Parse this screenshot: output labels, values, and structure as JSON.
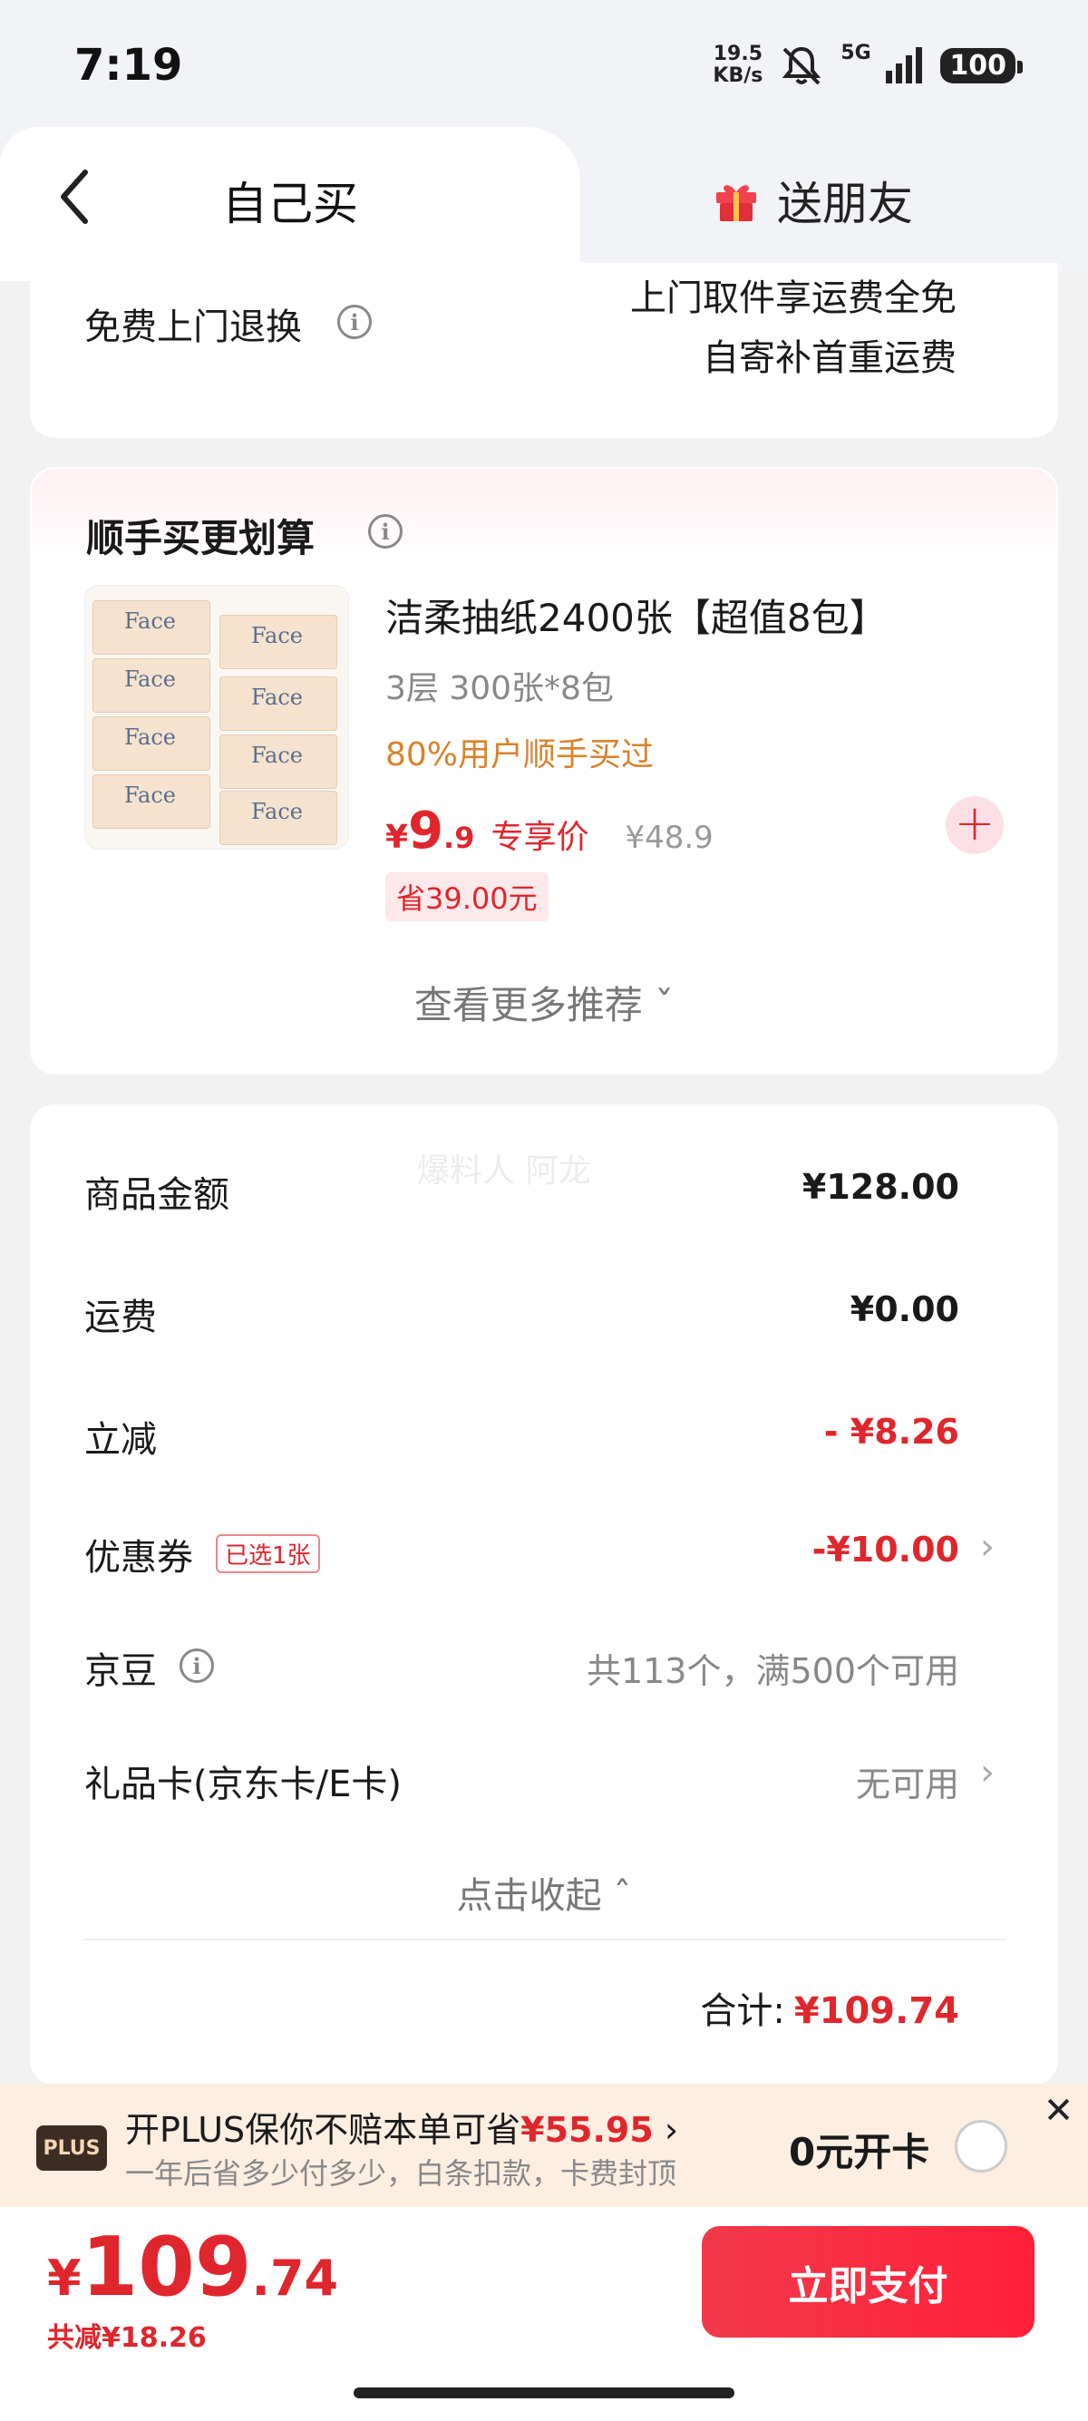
{
  "status_bar": {
    "time": "7:19",
    "net_speed_value": "19.5",
    "net_speed_unit": "KB/s",
    "network": "5G",
    "battery": "100"
  },
  "tabs": {
    "self": "自己买",
    "friend": "送朋友"
  },
  "return_service": {
    "label": "免费上门退换",
    "line1": "上门取件享运费全免",
    "line2": "自寄补首重运费"
  },
  "recommend": {
    "title": "顺手买更划算",
    "product": {
      "title": "洁柔抽纸2400张【超值8包】",
      "spec": "3层 300张*8包",
      "tag": "80%用户顺手买过",
      "price_symbol": "¥",
      "price_int": "9",
      "price_dec": ".9",
      "price_label": "专享价",
      "original_price": "¥48.9",
      "save": "省39.00元",
      "image_brand": "Face"
    },
    "more": "查看更多推荐 ˇ"
  },
  "summary": {
    "goods_label": "商品金额",
    "goods_value": "¥128.00",
    "shipping_label": "运费",
    "shipping_value": "¥0.00",
    "discount_label": "立减",
    "discount_value": "- ¥8.26",
    "coupon_label": "优惠券",
    "coupon_tag": "已选1张",
    "coupon_value": "-¥10.00",
    "jd_bean_label": "京豆",
    "jd_bean_value": "共113个，满500个可用",
    "gift_card_label": "礼品卡(京东卡/E卡)",
    "gift_card_value": "无可用",
    "collapse": "点击收起 ˆ",
    "total_label": "合计:",
    "total_value": "¥109.74",
    "watermark": "爆料人 阿龙"
  },
  "plus": {
    "logo": "PLUS",
    "line1_prefix": "开PLUS保你不赔本单可省",
    "line1_amount": "¥55.95",
    "line1_arrow": "›",
    "line2": "一年后省多少付多少，白条扣款，卡费封顶",
    "open": "0元开卡",
    "close": "✕"
  },
  "bottom": {
    "yen": "¥",
    "price_int": "109",
    "price_dec": ".74",
    "save": "共减¥18.26",
    "pay": "立即支付"
  },
  "colors": {
    "accent_red": "#e0262d",
    "tag_orange": "#d9822b",
    "plus_bg": "#fdeee2"
  }
}
